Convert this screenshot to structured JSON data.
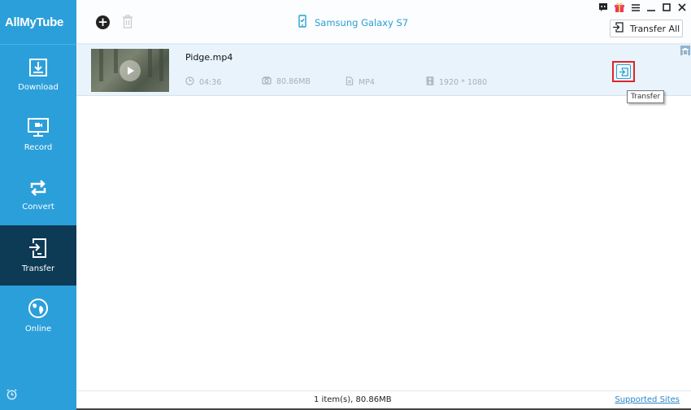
{
  "app": {
    "name": "AllMyTube"
  },
  "sidebar": {
    "items": [
      {
        "label": "Download",
        "icon": "download-icon",
        "active": false
      },
      {
        "label": "Record",
        "icon": "monitor-record-icon",
        "active": false
      },
      {
        "label": "Convert",
        "icon": "convert-icon",
        "active": false
      },
      {
        "label": "Transfer",
        "icon": "transfer-device-icon",
        "active": true
      },
      {
        "label": "Online",
        "icon": "globe-icon",
        "active": false
      }
    ],
    "bottom_icon": "alarm-clock-icon"
  },
  "toolbar": {
    "add_icon": "plus-circle-icon",
    "delete_icon": "trash-icon",
    "device_name": "Samsung Galaxy S7",
    "device_icon": "phone-check-icon",
    "transfer_all_label": "Transfer All",
    "window_controls": [
      "feedback-icon",
      "gift-icon",
      "menu-icon",
      "minimize-icon",
      "maximize-icon",
      "close-icon"
    ]
  },
  "files": [
    {
      "name": "Pidge.mp4",
      "duration": "04:36",
      "size": "80.86MB",
      "format": "MP4",
      "resolution": "1920 * 1080"
    }
  ],
  "tooltip": {
    "text": "Transfer"
  },
  "status": {
    "summary": "1 item(s), 80.86MB",
    "supported_sites_label": "Supported Sites"
  },
  "colors": {
    "sidebar": "#2b9fda",
    "sidebar_active": "#0d3a55",
    "accent": "#2a9fcf",
    "row_highlight": "#e9f3fc",
    "focus_border": "#e22424"
  }
}
